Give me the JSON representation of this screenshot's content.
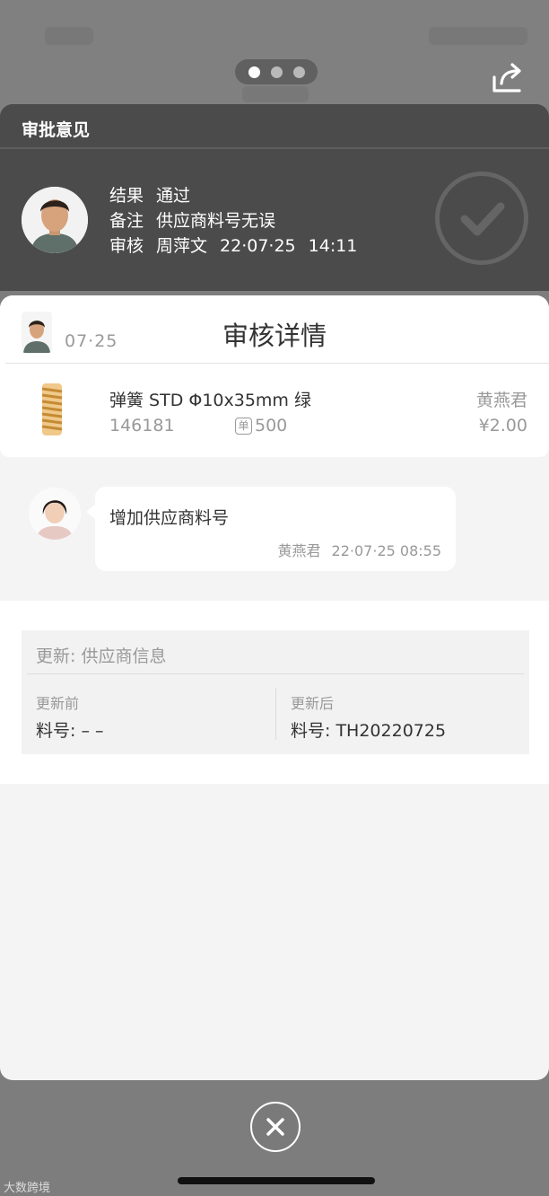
{
  "pager": {
    "count": 3,
    "active_index": 0
  },
  "icons": {
    "share": "share-icon",
    "check": "check-icon",
    "close": "close-icon",
    "unit": "unit-icon",
    "spring": "spring-icon"
  },
  "opinion": {
    "title": "审批意见",
    "result_label": "结果",
    "result_value": "通过",
    "remark_label": "备注",
    "remark_value": "供应商料号无误",
    "reviewer_label": "审核",
    "reviewer_name": "周萍文",
    "reviewer_date": "22·07·25",
    "reviewer_time": "14:11"
  },
  "detail": {
    "title": "审核详情",
    "date": "07·25"
  },
  "item": {
    "name": "弹簧 STD Φ10x35mm 绿",
    "code": "146181",
    "unit_mark": "单",
    "qty": "500",
    "owner": "黄燕君",
    "price": "¥2.00"
  },
  "comment": {
    "text": "增加供应商料号",
    "author": "黄燕君",
    "time": "22·07·25 08:55"
  },
  "update": {
    "title": "更新: 供应商信息",
    "before_label": "更新前",
    "before_value": "料号: – –",
    "after_label": "更新后",
    "after_value": "料号: TH20220725"
  },
  "watermark": "大数跨境",
  "colors": {
    "backdrop": "#7d7d7d",
    "opinion_bg": "#4b4b4b",
    "sheet_bg": "#f4f4f4",
    "card_bg": "#ffffff",
    "muted_text": "#999999",
    "spring_color": "#d9a24a"
  }
}
